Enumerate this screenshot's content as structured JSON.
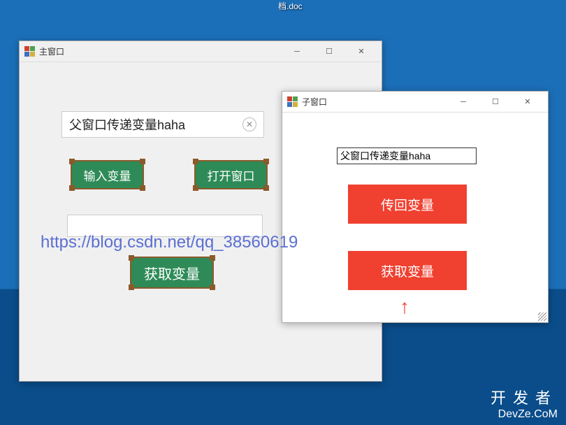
{
  "desktop": {
    "file_label": "档.doc"
  },
  "parent_window": {
    "title": "主窗口",
    "textbox_value": "父窗口传递变量haha",
    "btn_input_var": "输入变量",
    "btn_open_window": "打开窗口",
    "btn_get_var": "获取变量",
    "textbox2_value": ""
  },
  "child_window": {
    "title": "子窗口",
    "textbox_value": "父窗口传递变量haha",
    "btn_return_var": "传回变量",
    "btn_get_var": "获取变量"
  },
  "watermark": "https://blog.csdn.net/qq_38560619",
  "brand": {
    "cn": "开发者",
    "en": "DevZe.CoM"
  }
}
